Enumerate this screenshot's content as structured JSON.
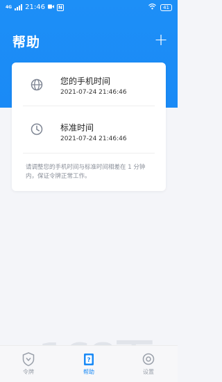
{
  "status_bar": {
    "network": "4G",
    "time": "21:46",
    "badge": "N",
    "battery": "41"
  },
  "header": {
    "title": "帮助",
    "add_label": "+"
  },
  "time_card": {
    "rows": [
      {
        "icon": "globe-icon",
        "title": "您的手机时间",
        "time": "2021-07-24 21:46:46"
      },
      {
        "icon": "clock-icon",
        "title": "标准时间",
        "time": "2021-07-24 21:46:46"
      }
    ],
    "note": "请调整您的手机时间与标准时间相差在 1 分钟内，保证令牌正常工作。"
  },
  "tabbar": {
    "tabs": [
      {
        "label": "令牌",
        "icon": "shield-icon",
        "active": false
      },
      {
        "label": "帮助",
        "icon": "help-icon",
        "active": true
      },
      {
        "label": "设置",
        "icon": "settings-icon",
        "active": false
      }
    ]
  },
  "watermark": {
    "text": "168下载",
    "sub": "GPS.com"
  },
  "colors": {
    "accent": "#1a8af6",
    "background": "#f4f5f9",
    "muted": "#9aa0aa"
  }
}
